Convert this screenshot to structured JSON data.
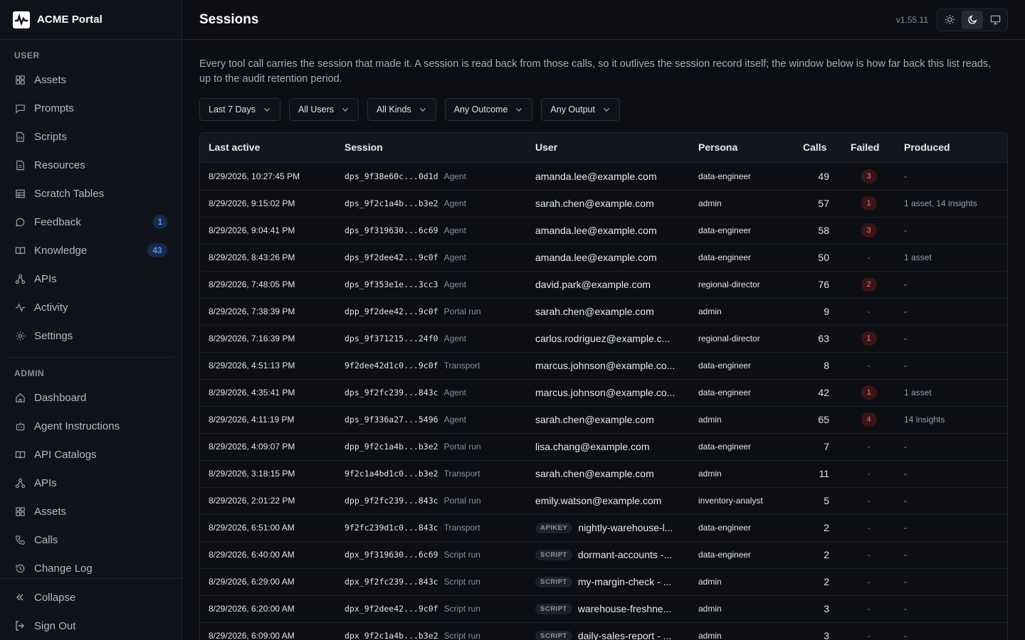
{
  "brand": {
    "name": "ACME Portal"
  },
  "sidebar": {
    "user_section_title": "USER",
    "user_items": [
      {
        "label": "Assets",
        "icon": "grid-icon"
      },
      {
        "label": "Prompts",
        "icon": "message-square-icon"
      },
      {
        "label": "Scripts",
        "icon": "file-code-icon"
      },
      {
        "label": "Resources",
        "icon": "file-icon"
      },
      {
        "label": "Scratch Tables",
        "icon": "table-icon"
      },
      {
        "label": "Feedback",
        "icon": "message-circle-icon",
        "badge": "1"
      },
      {
        "label": "Knowledge",
        "icon": "book-open-icon",
        "badge": "43"
      },
      {
        "label": "APIs",
        "icon": "network-icon"
      },
      {
        "label": "Activity",
        "icon": "activity-icon"
      },
      {
        "label": "Settings",
        "icon": "gear-icon"
      }
    ],
    "admin_section_title": "ADMIN",
    "admin_items": [
      {
        "label": "Dashboard",
        "icon": "home-icon"
      },
      {
        "label": "Agent Instructions",
        "icon": "bot-icon"
      },
      {
        "label": "API Catalogs",
        "icon": "book-open-icon"
      },
      {
        "label": "APIs",
        "icon": "network-icon"
      },
      {
        "label": "Assets",
        "icon": "grid-icon"
      },
      {
        "label": "Calls",
        "icon": "phone-icon"
      },
      {
        "label": "Change Log",
        "icon": "history-icon"
      }
    ],
    "footer": {
      "collapse": "Collapse",
      "sign_out": "Sign Out"
    }
  },
  "header": {
    "title": "Sessions",
    "version": "v1.55.11",
    "theme_active": "dark"
  },
  "description": "Every tool call carries the session that made it. A session is read back from those calls, so it outlives the session record itself; the window below is how far back this list reads, up to the audit retention period.",
  "filters": [
    "Last 7 Days",
    "All Users",
    "All Kinds",
    "Any Outcome",
    "Any Output"
  ],
  "table": {
    "columns": [
      "Last active",
      "Session",
      "User",
      "Persona",
      "Calls",
      "Failed",
      "Produced"
    ],
    "rows": [
      {
        "last_active": "8/29/2026, 10:27:45 PM",
        "session": "dps_9f38e60c...0d1d",
        "kind": "Agent",
        "tag": "",
        "user": "amanda.lee@example.com",
        "persona": "data-engineer",
        "calls": "49",
        "failed": "3",
        "produced": "-"
      },
      {
        "last_active": "8/29/2026, 9:15:02 PM",
        "session": "dps_9f2c1a4b...b3e2",
        "kind": "Agent",
        "tag": "",
        "user": "sarah.chen@example.com",
        "persona": "admin",
        "calls": "57",
        "failed": "1",
        "produced": "1 asset, 14 insights"
      },
      {
        "last_active": "8/29/2026, 9:04:41 PM",
        "session": "dps_9f319630...6c69",
        "kind": "Agent",
        "tag": "",
        "user": "amanda.lee@example.com",
        "persona": "data-engineer",
        "calls": "58",
        "failed": "3",
        "produced": "-"
      },
      {
        "last_active": "8/29/2026, 8:43:26 PM",
        "session": "dps_9f2dee42...9c0f",
        "kind": "Agent",
        "tag": "",
        "user": "amanda.lee@example.com",
        "persona": "data-engineer",
        "calls": "50",
        "failed": "-",
        "produced": "1 asset"
      },
      {
        "last_active": "8/29/2026, 7:48:05 PM",
        "session": "dps_9f353e1e...3cc3",
        "kind": "Agent",
        "tag": "",
        "user": "david.park@example.com",
        "persona": "regional-director",
        "calls": "76",
        "failed": "2",
        "produced": "-"
      },
      {
        "last_active": "8/29/2026, 7:38:39 PM",
        "session": "dpp_9f2dee42...9c0f",
        "kind": "Portal run",
        "tag": "",
        "user": "sarah.chen@example.com",
        "persona": "admin",
        "calls": "9",
        "failed": "-",
        "produced": "-"
      },
      {
        "last_active": "8/29/2026, 7:16:39 PM",
        "session": "dps_9f371215...24f0",
        "kind": "Agent",
        "tag": "",
        "user": "carlos.rodriguez@example.c...",
        "persona": "regional-director",
        "calls": "63",
        "failed": "1",
        "produced": "-"
      },
      {
        "last_active": "8/29/2026, 4:51:13 PM",
        "session": "9f2dee42d1c0...9c0f",
        "kind": "Transport",
        "tag": "",
        "user": "marcus.johnson@example.co...",
        "persona": "data-engineer",
        "calls": "8",
        "failed": "-",
        "produced": "-"
      },
      {
        "last_active": "8/29/2026, 4:35:41 PM",
        "session": "dps_9f2fc239...843c",
        "kind": "Agent",
        "tag": "",
        "user": "marcus.johnson@example.co...",
        "persona": "data-engineer",
        "calls": "42",
        "failed": "1",
        "produced": "1 asset"
      },
      {
        "last_active": "8/29/2026, 4:11:19 PM",
        "session": "dps_9f336a27...5496",
        "kind": "Agent",
        "tag": "",
        "user": "sarah.chen@example.com",
        "persona": "admin",
        "calls": "65",
        "failed": "4",
        "produced": "14 insights"
      },
      {
        "last_active": "8/29/2026, 4:09:07 PM",
        "session": "dpp_9f2c1a4b...b3e2",
        "kind": "Portal run",
        "tag": "",
        "user": "lisa.chang@example.com",
        "persona": "data-engineer",
        "calls": "7",
        "failed": "-",
        "produced": "-"
      },
      {
        "last_active": "8/29/2026, 3:18:15 PM",
        "session": "9f2c1a4bd1c0...b3e2",
        "kind": "Transport",
        "tag": "",
        "user": "sarah.chen@example.com",
        "persona": "admin",
        "calls": "11",
        "failed": "-",
        "produced": "-"
      },
      {
        "last_active": "8/29/2026, 2:01:22 PM",
        "session": "dpp_9f2fc239...843c",
        "kind": "Portal run",
        "tag": "",
        "user": "emily.watson@example.com",
        "persona": "inventory-analyst",
        "calls": "5",
        "failed": "-",
        "produced": "-"
      },
      {
        "last_active": "8/29/2026, 6:51:00 AM",
        "session": "9f2fc239d1c0...843c",
        "kind": "Transport",
        "tag": "APIKEY",
        "user": "nightly-warehouse-l...",
        "persona": "data-engineer",
        "calls": "2",
        "failed": "-",
        "produced": "-"
      },
      {
        "last_active": "8/29/2026, 6:40:00 AM",
        "session": "dpx_9f319630...6c69",
        "kind": "Script run",
        "tag": "SCRIPT",
        "user": "dormant-accounts -...",
        "persona": "data-engineer",
        "calls": "2",
        "failed": "-",
        "produced": "-"
      },
      {
        "last_active": "8/29/2026, 6:29:00 AM",
        "session": "dpx_9f2fc239...843c",
        "kind": "Script run",
        "tag": "SCRIPT",
        "user": "my-margin-check - ...",
        "persona": "admin",
        "calls": "2",
        "failed": "-",
        "produced": "-"
      },
      {
        "last_active": "8/29/2026, 6:20:00 AM",
        "session": "dpx_9f2dee42...9c0f",
        "kind": "Script run",
        "tag": "SCRIPT",
        "user": "warehouse-freshne...",
        "persona": "admin",
        "calls": "3",
        "failed": "-",
        "produced": "-"
      },
      {
        "last_active": "8/29/2026, 6:09:00 AM",
        "session": "dpx_9f2c1a4b...b3e2",
        "kind": "Script run",
        "tag": "SCRIPT",
        "user": "daily-sales-report - ...",
        "persona": "admin",
        "calls": "3",
        "failed": "-",
        "produced": "-"
      }
    ]
  }
}
